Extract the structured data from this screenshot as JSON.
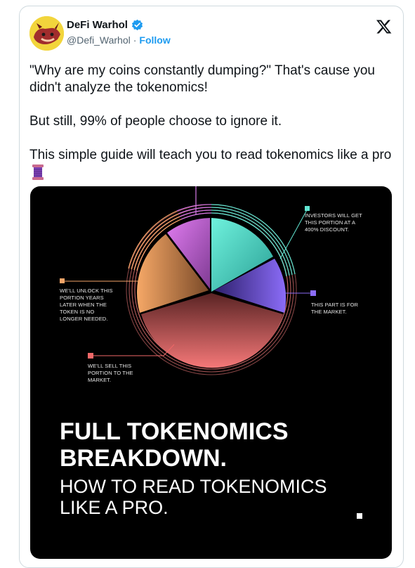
{
  "tweet": {
    "author": {
      "display_name": "DeFi Warhol",
      "handle": "@Defi_Warhol",
      "follow_label": "Follow",
      "verified": true
    },
    "platform_logo": "x-logo",
    "text": {
      "p1": "\"Why are my coins constantly dumping?\" That's cause you didn't analyze the tokenomics!",
      "p2": "But still, 99% of people choose to ignore it.",
      "p3": "This simple guide will teach you to read tokenomics like a pro",
      "emoji": "spool-of-thread-emoji"
    }
  },
  "media": {
    "annotations": {
      "investors": "INVESTORS WILL GET THIS PORTION AT A 400% DISCOUNT.",
      "market": "THIS PART IS FOR THE MARKET.",
      "unlock": "WE'LL UNLOCK THIS PORTION YEARS LATER WHEN THE TOKEN IS NO LONGER NEEDED.",
      "sell": "WE'LL SELL THIS PORTION TO THE MARKET."
    },
    "title": "FULL TOKENOMICS BREAKDOWN.",
    "subtitle": "HOW TO READ TOKENOMICS LIKE A PRO.",
    "colors": {
      "teal": "#56e0cf",
      "purple": "#7b63f0",
      "orange": "#f0a062",
      "pink": "#d770e8",
      "red": "#f06868"
    }
  }
}
